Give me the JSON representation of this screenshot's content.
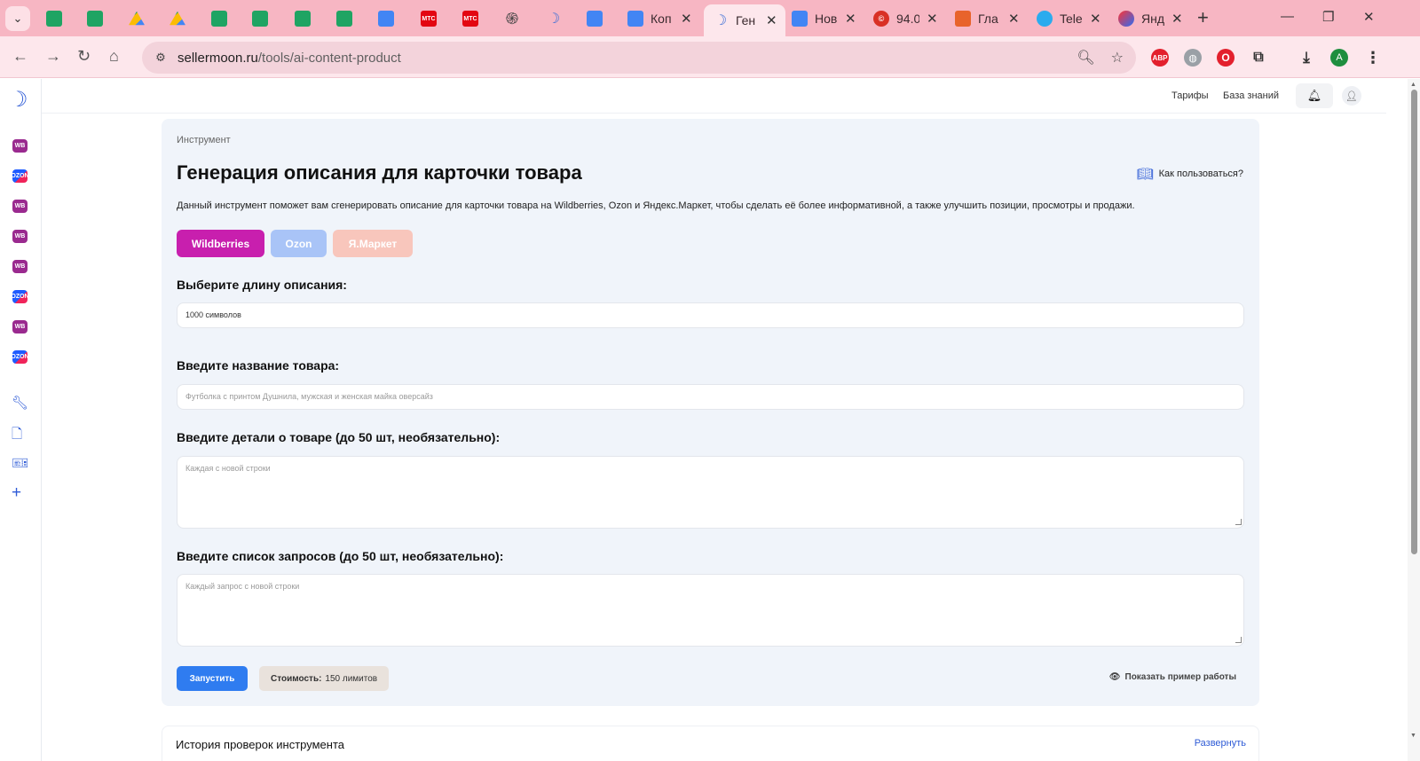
{
  "browser": {
    "tabs": [
      {
        "icon": "sheets",
        "title": ""
      },
      {
        "icon": "sheets",
        "title": ""
      },
      {
        "icon": "drive",
        "title": ""
      },
      {
        "icon": "drive",
        "title": ""
      },
      {
        "icon": "sheets",
        "title": ""
      },
      {
        "icon": "sheets",
        "title": ""
      },
      {
        "icon": "sheets",
        "title": ""
      },
      {
        "icon": "sheets",
        "title": ""
      },
      {
        "icon": "docs",
        "title": ""
      },
      {
        "icon": "mts",
        "title": ""
      },
      {
        "icon": "mts",
        "title": ""
      },
      {
        "icon": "gpt",
        "title": ""
      },
      {
        "icon": "moon",
        "title": ""
      },
      {
        "icon": "docs",
        "title": ""
      },
      {
        "icon": "docs",
        "title": "Коп"
      },
      {
        "icon": "moon",
        "title": "Ген"
      },
      {
        "icon": "docs",
        "title": "Нов"
      },
      {
        "icon": "red",
        "title": "94.0"
      },
      {
        "icon": "orange",
        "title": "Гла"
      },
      {
        "icon": "tg",
        "title": "Tele"
      },
      {
        "icon": "yandex",
        "title": "Янд"
      }
    ],
    "fav_text": {
      "mts": "МТС",
      "gpt": "֍",
      "moon": "☽",
      "red": "©"
    },
    "url_host": "sellermoon.ru",
    "url_path": "/tools/ai-content-product",
    "profile_letter": "A",
    "abp_label": "ABP"
  },
  "sidebar": {
    "items": [
      "WB",
      "OZON",
      "WB",
      "WB",
      "WB",
      "OZON",
      "WB",
      "OZON"
    ]
  },
  "topnav": {
    "tariffs": "Тарифы",
    "knowledge": "База знаний"
  },
  "tool": {
    "breadcrumb": "Инструмент",
    "title": "Генерация описания для карточки товара",
    "howto": "Как пользоваться?",
    "description": "Данный инструмент поможет вам сгенерировать описание для карточки товара на Wildberries, Ozon и Яндекс.Маркет, чтобы сделать её более информативной, а также улучшить позиции, просмотры и продажи.",
    "marketplaces": [
      "Wildberries",
      "Ozon",
      "Я.Маркет"
    ],
    "length_label": "Выберите длину описания:",
    "length_value": "1000 символов",
    "name_label": "Введите название товара:",
    "name_placeholder": "Футболка с принтом Душнила, мужская и женская майка оверсайз",
    "details_label": "Введите детали о товаре (до 50 шт, необязательно):",
    "details_placeholder": "Каждая с новой строки",
    "queries_label": "Введите список запросов (до 50 шт, необязательно):",
    "queries_placeholder": "Каждый запрос с новой строки",
    "run_button": "Запустить",
    "cost_label": "Стоимость:",
    "cost_value": "150 лимитов",
    "example_link": "Показать пример работы"
  },
  "history": {
    "title": "История проверок инструмента",
    "expand": "Развернуть"
  },
  "colors": {
    "wildberries": "#c81fae",
    "ozon": "#a9c4f7",
    "yandex_market": "#f8c6bc",
    "run_button": "#2f7cf0",
    "brand": "#2e5bd6"
  }
}
